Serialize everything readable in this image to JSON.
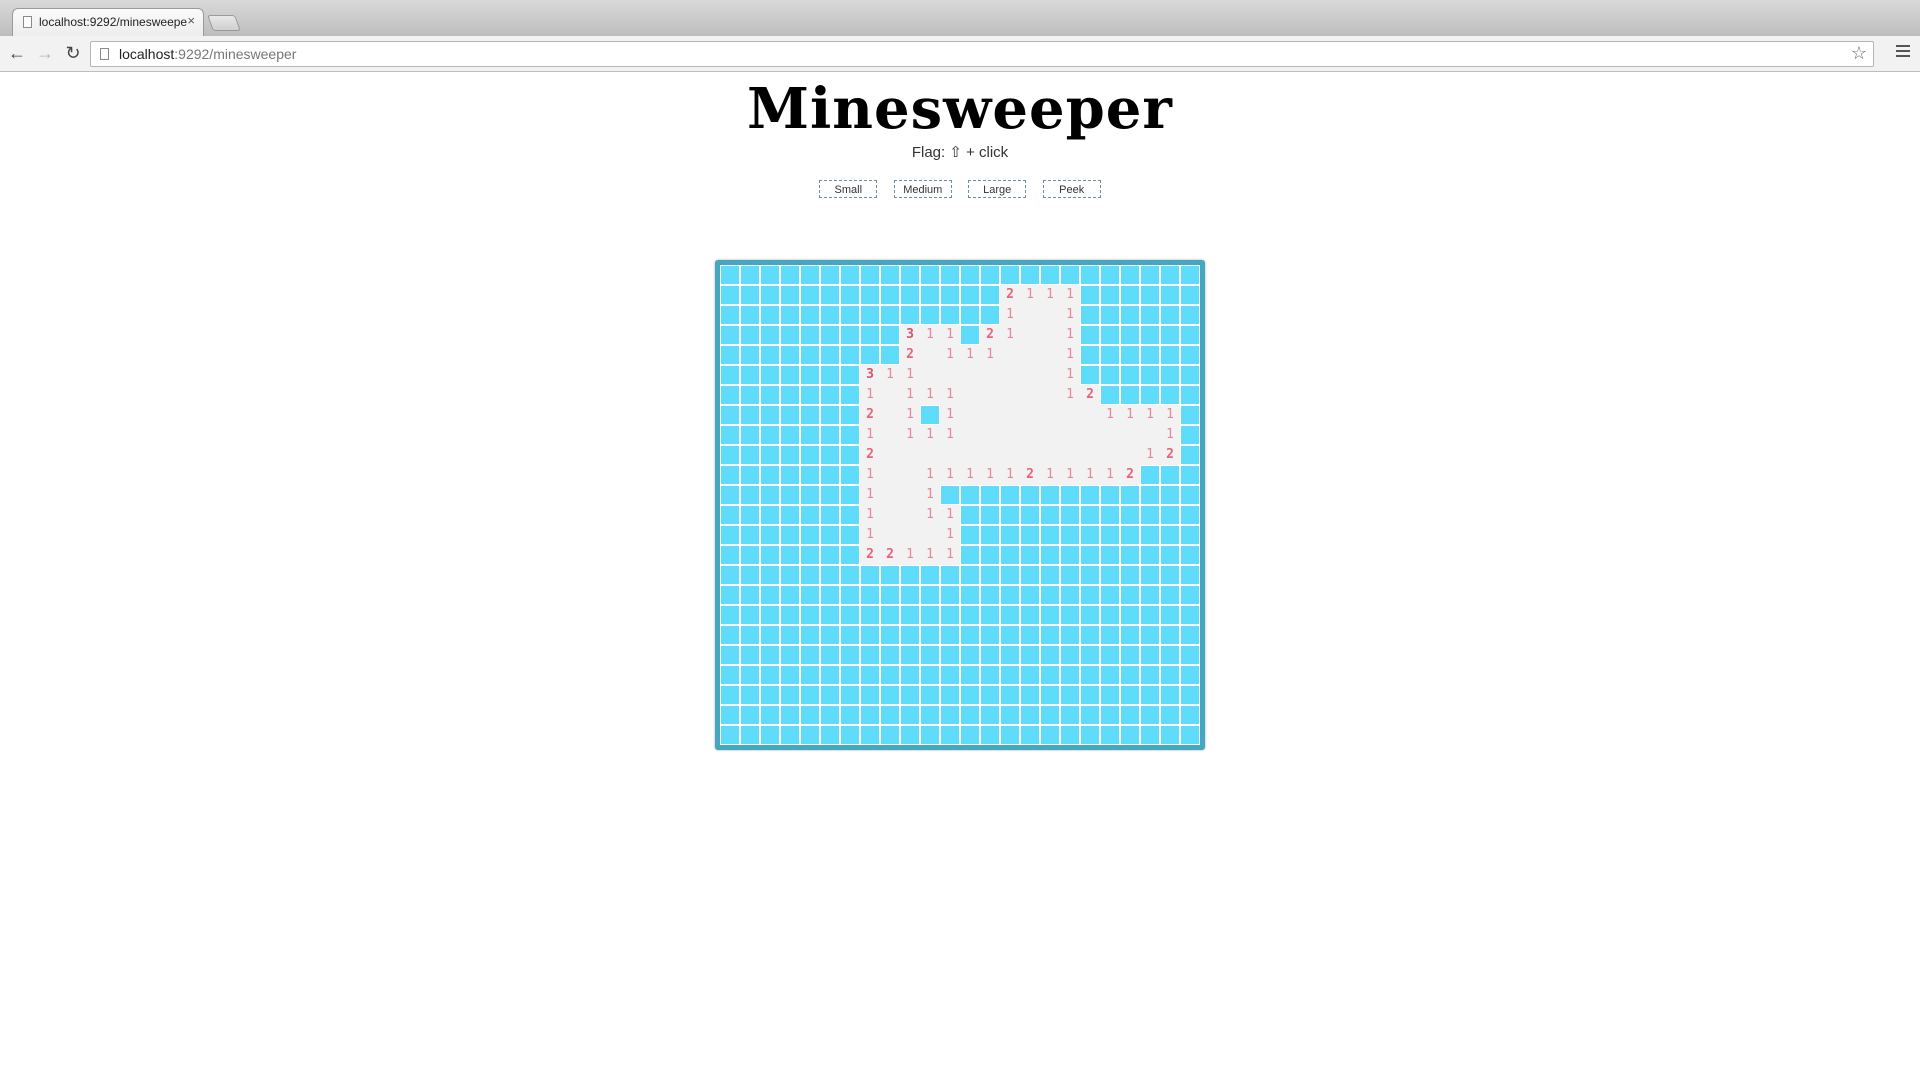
{
  "browser": {
    "tab_title": "localhost:9292/minesweeper",
    "tab_close": "×",
    "url_host": "localhost",
    "url_rest": ":9292/minesweeper"
  },
  "page": {
    "heading": "Minesweeper",
    "flag_hint": "Flag: ⇧ + click",
    "levels": [
      "Small",
      "Medium",
      "Large",
      "Peek"
    ]
  },
  "board": {
    "rows": [
      "########################",
      "##############2111######",
      "##############1..1######",
      "#########311#21..1######",
      "#########2.111...1######",
      "#######311.......1######",
      "#######1.111.....12#####",
      "#######2.1#1.......1111#",
      "#######1.111..........1#",
      "#######2.............12#",
      "#######1..11111211112###",
      "#######1..1#############",
      "#######1..11############",
      "#######1...1############",
      "#######22111############",
      "########################",
      "########################",
      "########################",
      "########################",
      "########################",
      "########################",
      "########################",
      "########################",
      "########################"
    ],
    "legend": {
      "#": "unrevealed",
      ".": "revealed-empty",
      "digit": "revealed-count"
    }
  }
}
